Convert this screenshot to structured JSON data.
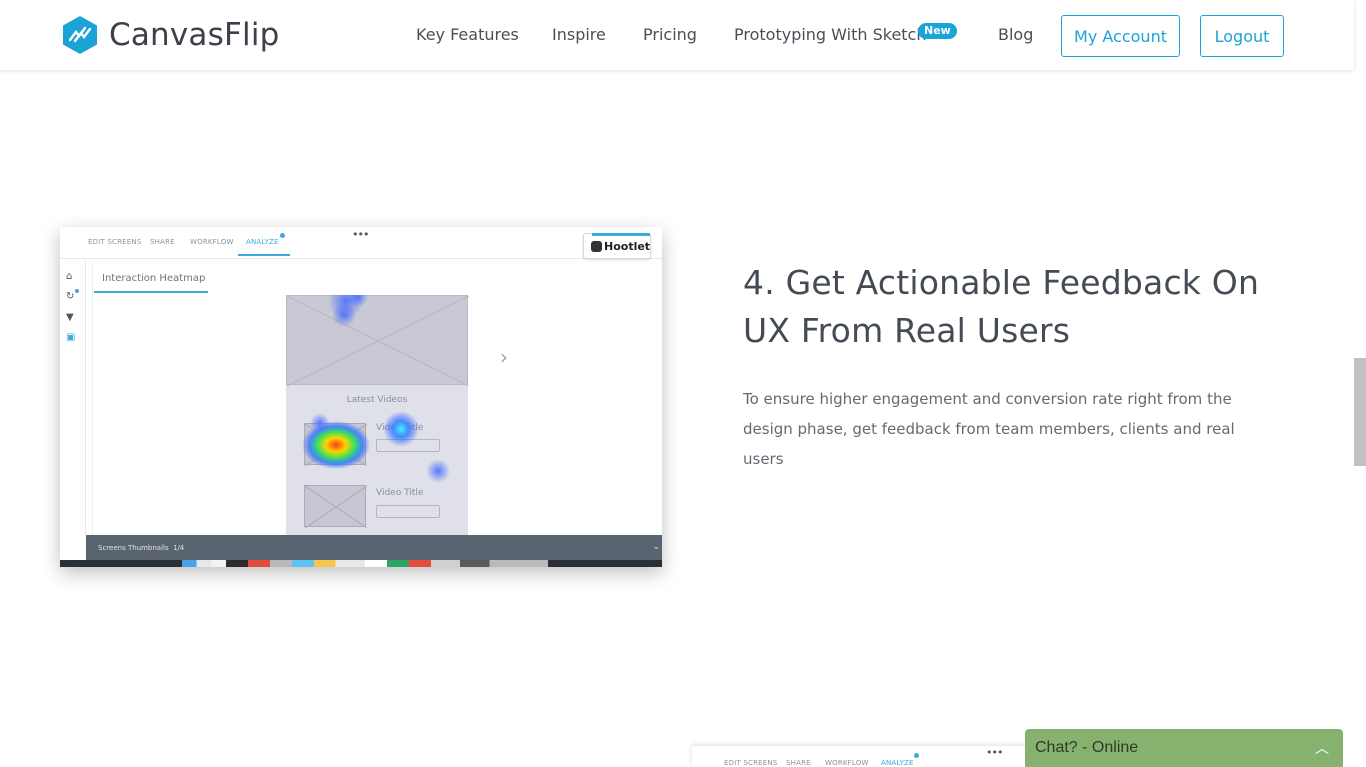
{
  "header": {
    "brand": "CanvasFlip",
    "nav": [
      {
        "label": "Key Features"
      },
      {
        "label": "Inspire"
      },
      {
        "label": "Pricing"
      },
      {
        "label": "Prototyping With Sketch"
      },
      {
        "label": "Blog"
      }
    ],
    "new_badge": "New",
    "my_account": "My Account",
    "logout": "Logout"
  },
  "colors": {
    "accent": "#1ba3d8",
    "chat": "#86b16e"
  },
  "feature": {
    "title": "4. Get Actionable Feedback On UX From Real Users",
    "description": "To ensure higher engagement and conversion rate right from the design phase, get feedback from team members, clients and real users"
  },
  "screenshot": {
    "tabs": [
      "EDIT SCREENS",
      "SHARE",
      "WORKFLOW",
      "ANALYZE"
    ],
    "hootlet": "Hootlet",
    "subtab": "Interaction Heatmap",
    "section_title": "Latest Videos",
    "video_title_1": "Video Title",
    "video_title_2": "Video Title",
    "bottom_label": "Screens Thumbnails",
    "bottom_count": "1/4"
  },
  "screenshot2": {
    "tabs": [
      "EDIT SCREENS",
      "SHARE",
      "WORKFLOW",
      "ANALYZE"
    ]
  },
  "chat": {
    "label": "Chat? - Online"
  }
}
